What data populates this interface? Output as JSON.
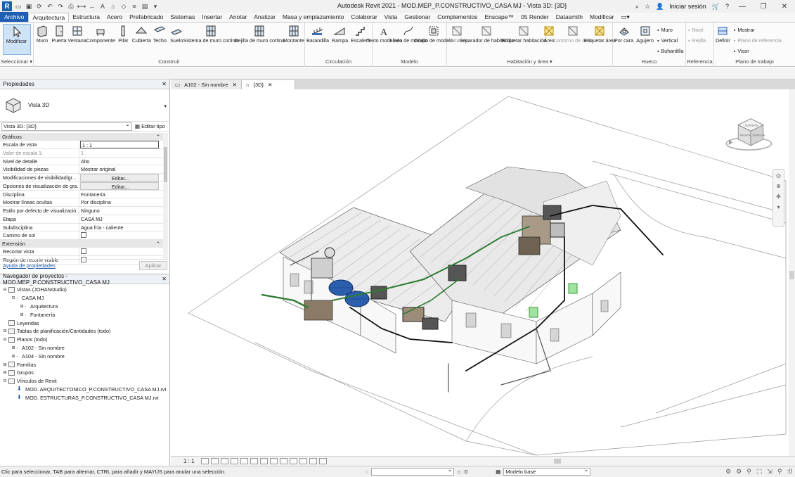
{
  "app": {
    "title": "Autodesk Revit 2021 - MOD.MEP_P.CONSTRUCTIVO_CASA MJ - Vista 3D: {3D}",
    "sign_in": "Iniciar sesión",
    "help": "?",
    "logo": "R"
  },
  "ribbon_tabs": [
    "Archivo",
    "Arquitectura",
    "Estructura",
    "Acero",
    "Prefabricado",
    "Sistemas",
    "Insertar",
    "Anotar",
    "Analizar",
    "Masa y emplazamiento",
    "Colaborar",
    "Vista",
    "Gestionar",
    "Complementos",
    "Enscape™",
    "05 Render",
    "Datasmith",
    "Modificar"
  ],
  "panels": {
    "seleccionar": {
      "label": "Seleccionar ▾",
      "tools": [
        {
          "label": "Modificar",
          "icon": "cursor-icon"
        }
      ]
    },
    "construir": {
      "label": "Construir",
      "tools": [
        {
          "label": "Muro",
          "icon": "wall-icon"
        },
        {
          "label": "Puerta",
          "icon": "door-icon"
        },
        {
          "label": "Ventana",
          "icon": "window-icon"
        },
        {
          "label": "Componente",
          "icon": "component-icon"
        },
        {
          "label": "Pilar",
          "icon": "column-icon"
        },
        {
          "label": "Cubierta",
          "icon": "roof-icon"
        },
        {
          "label": "Techo",
          "icon": "ceiling-icon"
        },
        {
          "label": "Suelo",
          "icon": "floor-icon"
        },
        {
          "label": "Sistema de muro cortina",
          "icon": "curtain-system-icon"
        },
        {
          "label": "Rejilla de muro cortina",
          "icon": "curtain-grid-icon"
        },
        {
          "label": "Montante",
          "icon": "mullion-icon"
        }
      ]
    },
    "circulacion": {
      "label": "Circulación",
      "tools": [
        {
          "label": "Barandilla",
          "icon": "railing-icon"
        },
        {
          "label": "Rampa",
          "icon": "ramp-icon"
        },
        {
          "label": "Escalera",
          "icon": "stair-icon"
        }
      ]
    },
    "modelo": {
      "label": "Modelo",
      "tools": [
        {
          "label": "Texto modelado",
          "icon": "model-text-icon"
        },
        {
          "label": "Línea de modelo",
          "icon": "model-line-icon"
        },
        {
          "label": "Grupo de modelo",
          "icon": "model-group-icon"
        }
      ]
    },
    "habitacion": {
      "label": "Habitación y área ▾",
      "tools": [
        {
          "label": "Habitación",
          "icon": "room-icon",
          "disabled": true
        },
        {
          "label": "Separador de habitación",
          "icon": "room-separator-icon"
        },
        {
          "label": "Etiquetar habitación",
          "icon": "tag-room-icon"
        },
        {
          "label": "Área",
          "icon": "area-icon"
        },
        {
          "label": "Contorno de área",
          "icon": "area-boundary-icon",
          "disabled": true
        },
        {
          "label": "Etiquetar área",
          "icon": "tag-area-icon"
        }
      ]
    },
    "hueco": {
      "label": "Hueco",
      "tools": [
        {
          "label": "Por cara",
          "icon": "by-face-icon"
        },
        {
          "label": "Agujero",
          "icon": "shaft-icon"
        }
      ],
      "small": [
        "Muro",
        "Vertical",
        "Buhardilla"
      ]
    },
    "referencia": {
      "label": "Referencia",
      "small": [
        "Nivel",
        "Rejilla"
      ]
    },
    "plano_trabajo": {
      "label": "Plano de trabajo",
      "tools": [
        {
          "label": "Definir",
          "icon": "set-workplane-icon"
        }
      ],
      "small": [
        "Mostrar",
        "Plano de referencia",
        "Visor"
      ]
    }
  },
  "properties": {
    "title": "Propiedades",
    "type_name": "Vista 3D",
    "view_selector": "Vista 3D: {3D}",
    "edit_type": "Editar tipo",
    "categories": [
      {
        "name": "Gráficos",
        "rows": [
          {
            "k": "Escala de vista",
            "v": "1 : 1",
            "kind": "input"
          },
          {
            "k": "Valor de escala    1:",
            "v": "1",
            "kind": "grey"
          },
          {
            "k": "Nivel de detalle",
            "v": "Alto"
          },
          {
            "k": "Visibilidad de piezas",
            "v": "Mostrar original"
          },
          {
            "k": "Modificaciones de visibilidad/gr...",
            "v": "Editar...",
            "kind": "btn"
          },
          {
            "k": "Opciones de visualización de gra...",
            "v": "Editar...",
            "kind": "btn"
          },
          {
            "k": "Disciplina",
            "v": "Fontanería"
          },
          {
            "k": "Mostrar líneas ocultas",
            "v": "Por disciplina"
          },
          {
            "k": "Estilo por defecto de visualizació...",
            "v": "Ninguno"
          },
          {
            "k": "Etapa",
            "v": "CASA MJ"
          },
          {
            "k": "Subdisciplina",
            "v": "Agua fría - caliente"
          },
          {
            "k": "Camino de sol",
            "v": "",
            "kind": "check"
          }
        ]
      },
      {
        "name": "Extensión",
        "rows": [
          {
            "k": "Recortar vista",
            "v": "",
            "kind": "check"
          },
          {
            "k": "Región de recorte visible",
            "v": "",
            "kind": "check"
          }
        ]
      }
    ],
    "help_link": "Ayuda de propiedades",
    "apply": "Aplicar"
  },
  "browser": {
    "title": "Navegador de proyectos - MOD.MEP_P.CONSTRUCTIVO_CASA MJ",
    "items": [
      {
        "indent": 0,
        "toggle": "⊟",
        "icon": "views-icon",
        "label": "Vistas (JOHANstudio)"
      },
      {
        "indent": 1,
        "toggle": "⊟",
        "icon": "",
        "label": "CASA MJ"
      },
      {
        "indent": 2,
        "toggle": "⊞",
        "icon": "",
        "label": "Arquitectura"
      },
      {
        "indent": 2,
        "toggle": "⊞",
        "icon": "",
        "label": "Fontanería"
      },
      {
        "indent": 0,
        "toggle": "",
        "icon": "legends-icon",
        "label": "Leyendas"
      },
      {
        "indent": 0,
        "toggle": "⊞",
        "icon": "schedules-icon",
        "label": "Tablas de planificación/Cantidades (todo)"
      },
      {
        "indent": 0,
        "toggle": "⊟",
        "icon": "sheets-icon",
        "label": "Planos (todo)"
      },
      {
        "indent": 1,
        "toggle": "⊞",
        "icon": "",
        "label": "A102 - Sin nombre"
      },
      {
        "indent": 1,
        "toggle": "⊞",
        "icon": "",
        "label": "A104 - Sin nombre"
      },
      {
        "indent": 0,
        "toggle": "⊞",
        "icon": "families-icon",
        "label": "Familias"
      },
      {
        "indent": 0,
        "toggle": "⊞",
        "icon": "groups-icon",
        "label": "Grupos"
      },
      {
        "indent": 0,
        "toggle": "⊟",
        "icon": "links-icon",
        "label": "Vínculos de Revit"
      },
      {
        "indent": 1,
        "toggle": "",
        "icon": "link-file-icon",
        "label": "MOD. ARQUITECTONICO_P.CONSTRUCTIVO_CASA MJ.rvt"
      },
      {
        "indent": 1,
        "toggle": "",
        "icon": "link-file-icon",
        "label": "MOD. ESTRUCTURAS_P.CONSTRUCTIVO_CASA MJ.rvt"
      }
    ]
  },
  "view_tabs": [
    {
      "label": "A102 - Sin nombre",
      "active": false
    },
    {
      "label": "{3D}",
      "active": true
    }
  ],
  "viewbar": {
    "scale": "1 : 1"
  },
  "viewcube": {
    "top": "SUPERIOR",
    "front": "FRONTAL",
    "right": "DERECHA"
  },
  "status": {
    "message": "Clic para seleccionar, TAB para alternar, CTRL para añadir y MAYÚS para anular una selección.",
    "zero": ":0",
    "model": "Modelo base"
  },
  "colors": {
    "file_tab": "#1e5fb3",
    "accent": "#1e5fb3",
    "pipe_green": "#2e7d32",
    "tank_blue": "#2b5fae",
    "highlight": "#cfe3f7"
  }
}
